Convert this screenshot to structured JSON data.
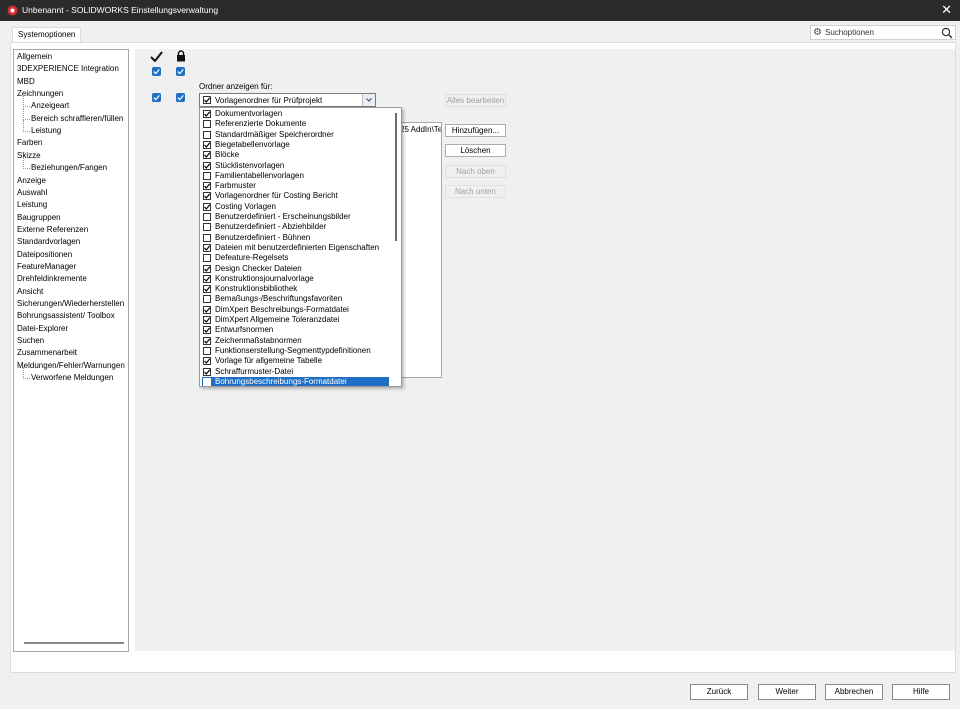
{
  "window": {
    "title": "Unbenannt - SOLIDWORKS Einstellungsverwaltung",
    "close_glyph": "✕"
  },
  "tabs": [
    "Systemoptionen"
  ],
  "search": {
    "placeholder": "Suchoptionen"
  },
  "tree": {
    "items": [
      {
        "label": "Allgemein",
        "level": 0
      },
      {
        "label": "3DEXPERIENCE Integration",
        "level": 0
      },
      {
        "label": "MBD",
        "level": 0
      },
      {
        "label": "Zeichnungen",
        "level": 0
      },
      {
        "label": "Anzeigeart",
        "level": 1
      },
      {
        "label": "Bereich schraffieren/füllen",
        "level": 1
      },
      {
        "label": "Leistung",
        "level": 1
      },
      {
        "label": "Farben",
        "level": 0
      },
      {
        "label": "Skizze",
        "level": 0
      },
      {
        "label": "Beziehungen/Fangen",
        "level": 1
      },
      {
        "label": "Anzeige",
        "level": 0
      },
      {
        "label": "Auswahl",
        "level": 0
      },
      {
        "label": "Leistung",
        "level": 0
      },
      {
        "label": "Baugruppen",
        "level": 0
      },
      {
        "label": "Externe Referenzen",
        "level": 0
      },
      {
        "label": "Standardvorlagen",
        "level": 0
      },
      {
        "label": "Dateipositionen",
        "level": 0
      },
      {
        "label": "FeatureManager",
        "level": 0
      },
      {
        "label": "Drehfeldinkremente",
        "level": 0
      },
      {
        "label": "Ansicht",
        "level": 0
      },
      {
        "label": "Sicherungen/Wiederherstellen",
        "level": 0
      },
      {
        "label": "Bohrungsassistent/ Toolbox",
        "level": 0
      },
      {
        "label": "Datei-Explorer",
        "level": 0
      },
      {
        "label": "Suchen",
        "level": 0
      },
      {
        "label": "Zusammenarbeit",
        "level": 0
      },
      {
        "label": "Meldungen/Fehler/Warnungen",
        "level": 0
      },
      {
        "label": "Verworfene Meldungen",
        "level": 1
      }
    ]
  },
  "header_icons": [
    "checkmark-icon",
    "lock-icon"
  ],
  "folder_section": {
    "label": "Ordner anzeigen für:",
    "selected": "Vorlagenordner für Prüfprojekt",
    "path_text": "25 AddIn\\Te"
  },
  "buttons": {
    "edit_all": "Alles bearbeiten",
    "add": "Hinzufügen...",
    "delete": "Löschen",
    "move_up": "Nach oben",
    "move_down": "Nach unten"
  },
  "dropdown": {
    "items": [
      {
        "label": "Dokumentvorlagen",
        "checked": true
      },
      {
        "label": "Referenzierte Dokumente",
        "checked": false
      },
      {
        "label": "Standardmäßiger Speicherordner",
        "checked": false
      },
      {
        "label": "Biegetabellenvorlage",
        "checked": true
      },
      {
        "label": "Blöcke",
        "checked": true
      },
      {
        "label": "Stücklistenvorlagen",
        "checked": true
      },
      {
        "label": "Familientabellenvorlagen",
        "checked": false
      },
      {
        "label": "Farbmuster",
        "checked": true
      },
      {
        "label": "Vorlagenordner für Costing Bericht",
        "checked": true
      },
      {
        "label": "Costing Vorlagen",
        "checked": true
      },
      {
        "label": "Benutzerdefiniert - Erscheinungsbilder",
        "checked": false
      },
      {
        "label": "Benutzerdefiniert - Abziehbilder",
        "checked": false
      },
      {
        "label": "Benutzerdefiniert -  Bühnen",
        "checked": false
      },
      {
        "label": "Dateien mit benutzerdefinierten Eigenschaften",
        "checked": true
      },
      {
        "label": "Defeature-Regelsets",
        "checked": false
      },
      {
        "label": "Design Checker Dateien",
        "checked": true
      },
      {
        "label": "Konstruktionsjournalvorlage",
        "checked": true
      },
      {
        "label": "Konstruktionsbibliothek",
        "checked": true
      },
      {
        "label": "Bemaßungs-/Beschriftungsfavoriten",
        "checked": false
      },
      {
        "label": "DimXpert Beschreibungs-Formatdatei",
        "checked": true
      },
      {
        "label": "DimXpert Allgemeine Toleranzdatei",
        "checked": true
      },
      {
        "label": "Entwurfsnormen",
        "checked": true
      },
      {
        "label": "Zeichenmaßstabnormen",
        "checked": true
      },
      {
        "label": "Funktionserstellung-Segmenttypdefinitionen",
        "checked": false
      },
      {
        "label": "Vorlage für allgemeine Tabelle",
        "checked": true
      },
      {
        "label": "Schraffurmuster-Datei",
        "checked": true
      },
      {
        "label": "Bohrungsbeschreibungs-Formatdatei",
        "checked": true,
        "selected": true
      }
    ]
  },
  "footer": {
    "back": "Zurück",
    "next": "Weiter",
    "cancel": "Abbrechen",
    "help": "Hilfe"
  },
  "colors": {
    "accent": "#1f6fc5",
    "titlebar": "#2b2b2b"
  }
}
